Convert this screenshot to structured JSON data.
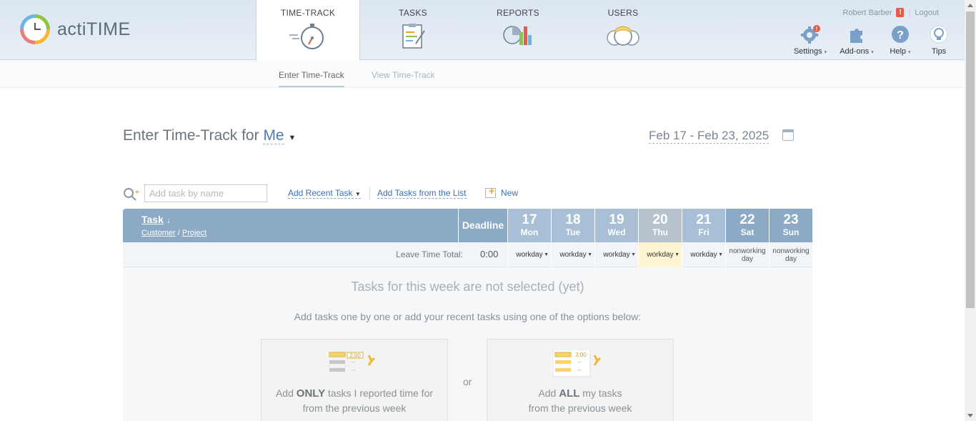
{
  "app": {
    "logo_text": "actiTIME"
  },
  "nav": {
    "tabs": [
      {
        "label": "TIME-TRACK"
      },
      {
        "label": "TASKS"
      },
      {
        "label": "REPORTS"
      },
      {
        "label": "USERS"
      }
    ]
  },
  "user": {
    "name": "Robert Barber",
    "warning": "!",
    "logout": "Logout"
  },
  "tools": [
    {
      "label": "Settings",
      "icon": "gear-icon"
    },
    {
      "label": "Add-ons",
      "icon": "puzzle-icon"
    },
    {
      "label": "Help",
      "icon": "help-icon"
    },
    {
      "label": "Tips",
      "icon": "lightbulb-icon"
    }
  ],
  "subnav": {
    "enter": "Enter Time-Track",
    "view": "View Time-Track"
  },
  "page": {
    "title": "Enter Time-Track for",
    "user_select": "Me",
    "date_range": "Feb 17 - Feb 23, 2025"
  },
  "add_task": {
    "placeholder": "Add task by name",
    "recent": "Add Recent Task",
    "from_list": "Add Tasks from the List",
    "new": "New"
  },
  "table": {
    "task_header": "Task",
    "task_sort": "↓",
    "customer": "Customer",
    "slash": "/",
    "project": "Project",
    "deadline": "Deadline",
    "days": [
      {
        "num": "17",
        "wd": "Mon",
        "type": "workday"
      },
      {
        "num": "18",
        "wd": "Tue",
        "type": "workday"
      },
      {
        "num": "19",
        "wd": "Wed",
        "type": "workday"
      },
      {
        "num": "20",
        "wd": "Thu",
        "type": "workday"
      },
      {
        "num": "21",
        "wd": "Fri",
        "type": "workday"
      },
      {
        "num": "22",
        "wd": "Sat",
        "type": "nonworking day"
      },
      {
        "num": "23",
        "wd": "Sun",
        "type": "nonworking day"
      }
    ],
    "leave_label": "Leave Time Total:",
    "leave_total": "0:00"
  },
  "empty": {
    "heading": "Tasks for this week are not selected (yet)",
    "sub": "Add tasks one by one or add your recent tasks using one of the options below:",
    "or": "or",
    "opt1": {
      "pre": "Add ",
      "bold": "ONLY",
      "post": " tasks I reported time for",
      "line2": "from the previous week",
      "time": "2:00",
      "dash": "--"
    },
    "opt2": {
      "pre": "Add ",
      "bold": "ALL",
      "post": " my tasks",
      "line2": "from the previous week",
      "time": "2:00",
      "dash": "--"
    }
  }
}
